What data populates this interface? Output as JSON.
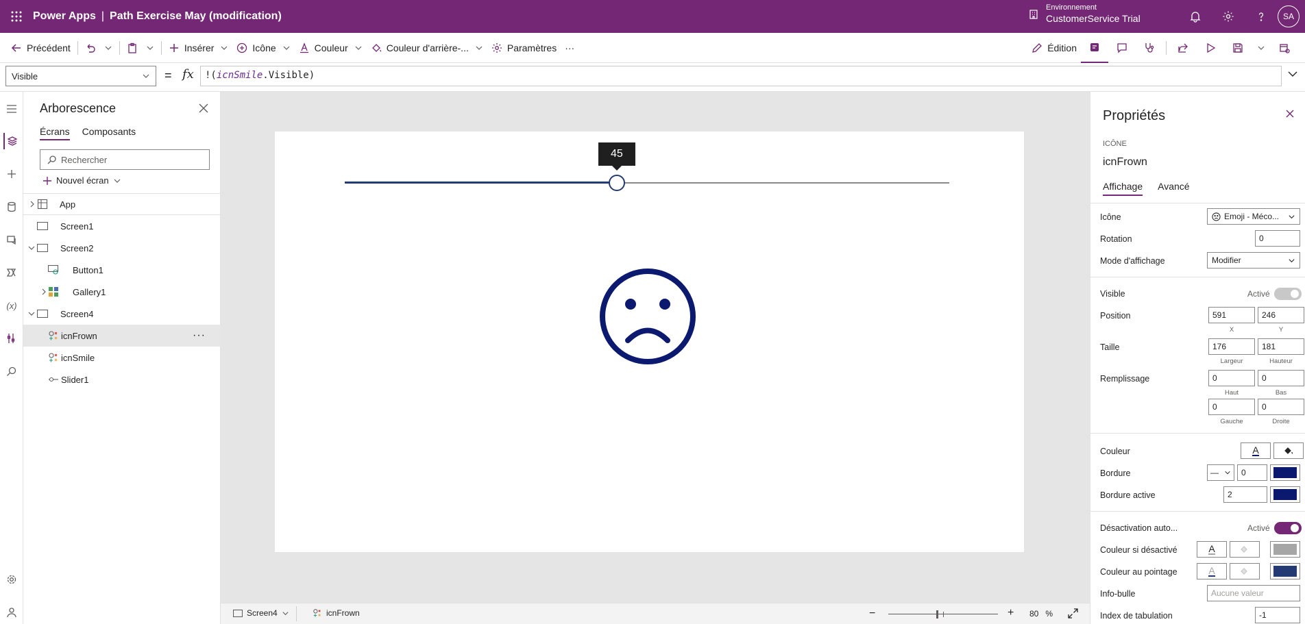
{
  "app": {
    "brand": "Power Apps",
    "separator": "|",
    "title": "Path Exercise May (modification)",
    "env_label": "Environnement",
    "env_value": "CustomerService Trial",
    "avatar": "SA"
  },
  "toolbar": {
    "back": "Précédent",
    "insert": "Insérer",
    "icon": "Icône",
    "color": "Couleur",
    "bgcolor": "Couleur d'arrière-...",
    "settings": "Paramètres",
    "more": "···",
    "edit": "Édition"
  },
  "formula": {
    "property": "Visible",
    "equals": "=",
    "fx": "fx",
    "prefix": "!(",
    "ref": "icnSmile",
    "suffix": ".Visible)"
  },
  "tree": {
    "title": "Arborescence",
    "tab_screens": "Écrans",
    "tab_components": "Composants",
    "search_placeholder": "Rechercher",
    "new_screen": "Nouvel écran",
    "nodes": [
      "App",
      "Screen1",
      "Screen2",
      "Button1",
      "Gallery1",
      "Screen4",
      "icnFrown",
      "icnSmile",
      "Slider1"
    ],
    "more": "···"
  },
  "canvas": {
    "slider_value": 45,
    "slider_label": "45",
    "slider_color": "#243a73",
    "icon_color": "#0b1a6e"
  },
  "bottom": {
    "screen": "Screen4",
    "control": "icnFrown",
    "zoom_minus": "−",
    "zoom_plus": "+",
    "zoom": "80",
    "zoom_unit": "%"
  },
  "props": {
    "title": "Propriétés",
    "type": "ICÔNE",
    "name": "icnFrown",
    "tab_display": "Affichage",
    "tab_advanced": "Avancé",
    "icon_label": "Icône",
    "icon_value": "Emoji - Méco...",
    "rotation_label": "Rotation",
    "rotation": "0",
    "mode_label": "Mode d'affichage",
    "mode_value": "Modifier",
    "visible_label": "Visible",
    "visible_state": "Activé",
    "position_label": "Position",
    "pos_x": "591",
    "pos_y": "246",
    "x_label": "X",
    "y_label": "Y",
    "size_label": "Taille",
    "width": "176",
    "height": "181",
    "width_label": "Largeur",
    "height_label": "Hauteur",
    "padding_label": "Remplissage",
    "pad_top": "0",
    "pad_bottom": "0",
    "pad_left": "0",
    "pad_right": "0",
    "top_label": "Haut",
    "bottom_label": "Bas",
    "left_label": "Gauche",
    "right_label": "Droite",
    "color_label": "Couleur",
    "border_label": "Bordure",
    "border_style": "—",
    "border_width": "0",
    "border_focus_label": "Bordure active",
    "border_focus": "2",
    "autodisable_label": "Désactivation auto...",
    "autodisable_state": "Activé",
    "disabled_color_label": "Couleur si désactivé",
    "hover_color_label": "Couleur au pointage",
    "tooltip_label": "Info-bulle",
    "tooltip_placeholder": "Aucune valeur",
    "tabindex_label": "Index de tabulation",
    "tabindex": "-1",
    "border_color": "#0b1a6e",
    "hover_color": "#243a73",
    "disabled_fill": "#a6a6a6"
  }
}
